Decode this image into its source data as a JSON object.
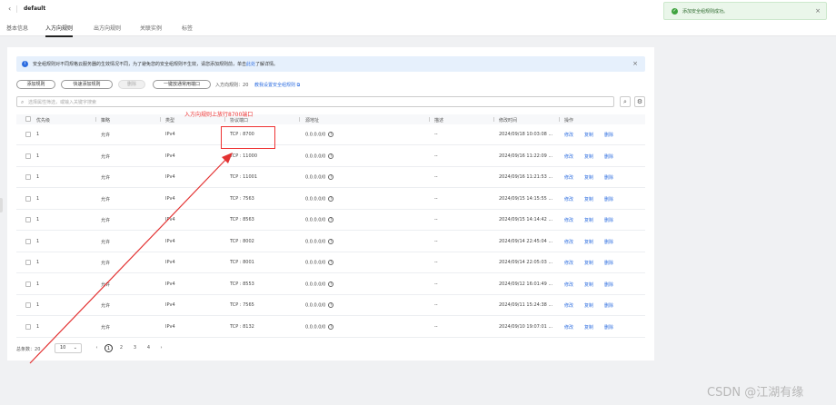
{
  "header": {
    "back_icon": "chevron-left-icon",
    "title": "default",
    "tabs": [
      {
        "label": "基本信息",
        "active": false
      },
      {
        "label": "入方向规则",
        "active": true
      },
      {
        "label": "出方向规则",
        "active": false
      },
      {
        "label": "关联实例",
        "active": false
      },
      {
        "label": "标签",
        "active": false
      }
    ]
  },
  "toast": {
    "icon": "check-circle-icon",
    "text": "添加安全组规则成功。",
    "close": "×"
  },
  "notice": {
    "icon": "info-icon",
    "text": "安全组规则对不同规格云服务器的生效情况不同，为了避免您的安全组规则不生效，请您添加规则前，单击",
    "link": "此处",
    "text_end": "了解详情。",
    "close": "×"
  },
  "toolbar": {
    "add_rule": "添加规则",
    "quick_add": "快速添加规则",
    "delete": "删除",
    "one_click": "一键放通常用端口",
    "rule_count_label": "入方向规则：",
    "rule_count": "20",
    "teach_link": "教我设置安全组规则",
    "teach_icon": "external-link-icon"
  },
  "search": {
    "placeholder": "选择属性筛选，或输入关键字搜索",
    "icon": "search-icon"
  },
  "table": {
    "columns": [
      "优先级",
      "策略",
      "类型",
      "协议端口",
      "源地址",
      "描述",
      "修改时间",
      "操作"
    ],
    "rows": [
      {
        "priority": "1",
        "policy": "允许",
        "type": "IPv4",
        "port": "TCP : 8700",
        "source": "0.0.0.0/0",
        "desc": "--",
        "time": "2024/09/18 10:03:08 ..."
      },
      {
        "priority": "1",
        "policy": "允许",
        "type": "IPv4",
        "port": "TCP : 11000",
        "source": "0.0.0.0/0",
        "desc": "--",
        "time": "2024/09/16 11:22:09 ..."
      },
      {
        "priority": "1",
        "policy": "允许",
        "type": "IPv4",
        "port": "TCP : 11001",
        "source": "0.0.0.0/0",
        "desc": "--",
        "time": "2024/09/16 11:21:53 ..."
      },
      {
        "priority": "1",
        "policy": "允许",
        "type": "IPv4",
        "port": "TCP : 7563",
        "source": "0.0.0.0/0",
        "desc": "--",
        "time": "2024/09/15 14:15:55 ..."
      },
      {
        "priority": "1",
        "policy": "允许",
        "type": "IPv4",
        "port": "TCP : 8563",
        "source": "0.0.0.0/0",
        "desc": "--",
        "time": "2024/09/15 14:14:42 ..."
      },
      {
        "priority": "1",
        "policy": "允许",
        "type": "IPv4",
        "port": "TCP : 8002",
        "source": "0.0.0.0/0",
        "desc": "--",
        "time": "2024/09/14 22:45:04 ..."
      },
      {
        "priority": "1",
        "policy": "允许",
        "type": "IPv4",
        "port": "TCP : 8001",
        "source": "0.0.0.0/0",
        "desc": "--",
        "time": "2024/09/14 22:05:03 ..."
      },
      {
        "priority": "1",
        "policy": "允许",
        "type": "IPv4",
        "port": "TCP : 8553",
        "source": "0.0.0.0/0",
        "desc": "--",
        "time": "2024/09/12 16:01:49 ..."
      },
      {
        "priority": "1",
        "policy": "允许",
        "type": "IPv4",
        "port": "TCP : 7565",
        "source": "0.0.0.0/0",
        "desc": "--",
        "time": "2024/09/11 15:24:38 ..."
      },
      {
        "priority": "1",
        "policy": "允许",
        "type": "IPv4",
        "port": "TCP : 8132",
        "source": "0.0.0.0/0",
        "desc": "--",
        "time": "2024/09/10 19:07:01 ..."
      }
    ],
    "ops": [
      "修改",
      "复制",
      "删除"
    ]
  },
  "pager": {
    "total_label": "总条数：",
    "total": "20",
    "page_size": "10",
    "pages": [
      "1",
      "2",
      "3",
      "4"
    ],
    "current": "1"
  },
  "annotation": {
    "text": "入方向规则上放行8700端口",
    "color": "#e33333"
  },
  "watermark": "CSDN @江湖有缘"
}
